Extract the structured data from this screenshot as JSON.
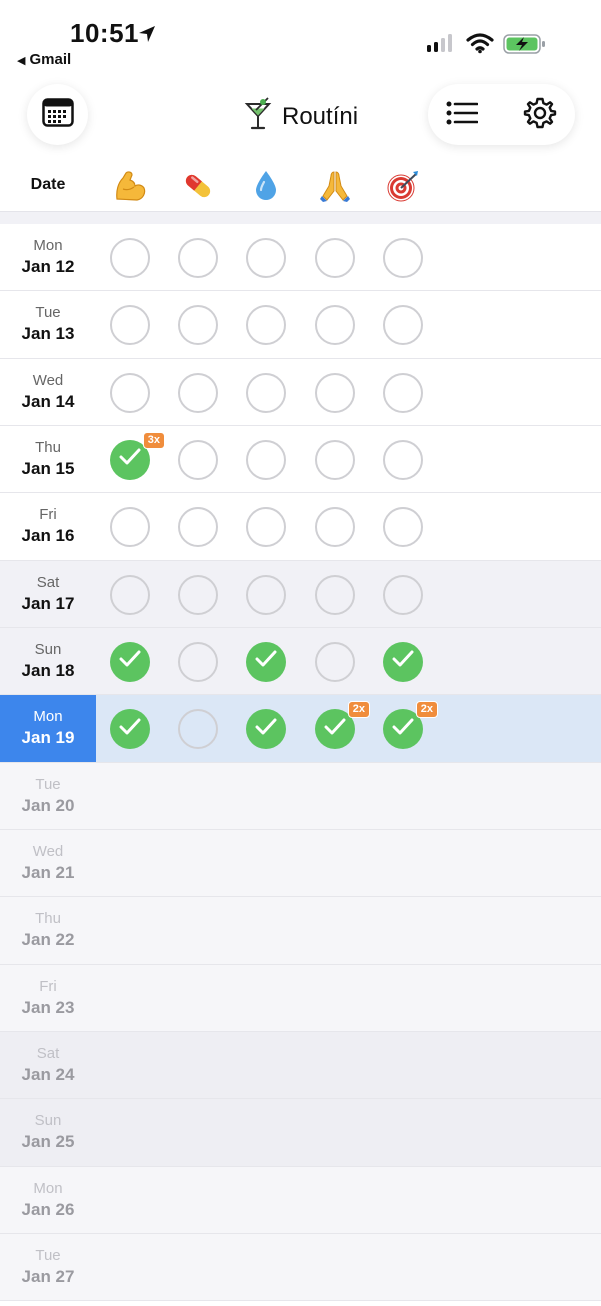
{
  "status_bar": {
    "time": "10:51",
    "back_app": "Gmail"
  },
  "app": {
    "title": "Routíni"
  },
  "columns": {
    "date_label": "Date",
    "habits": [
      {
        "emoji": "💪",
        "name": "flexed-biceps"
      },
      {
        "emoji": "💊",
        "name": "pill"
      },
      {
        "emoji": "💧",
        "name": "droplet"
      },
      {
        "emoji": "🙏",
        "name": "folded-hands"
      },
      {
        "emoji": "🎯",
        "name": "direct-hit"
      }
    ]
  },
  "rows": [
    {
      "dow": "Mon",
      "date": "Jan 12",
      "state": "past",
      "checks": [
        0,
        0,
        0,
        0,
        0
      ]
    },
    {
      "dow": "Tue",
      "date": "Jan 13",
      "state": "past",
      "checks": [
        0,
        0,
        0,
        0,
        0
      ]
    },
    {
      "dow": "Wed",
      "date": "Jan 14",
      "state": "past",
      "checks": [
        0,
        0,
        0,
        0,
        0
      ]
    },
    {
      "dow": "Thu",
      "date": "Jan 15",
      "state": "past",
      "checks": [
        1,
        0,
        0,
        0,
        0
      ],
      "badges": [
        "3x",
        "",
        "",
        "",
        ""
      ]
    },
    {
      "dow": "Fri",
      "date": "Jan 16",
      "state": "past",
      "checks": [
        0,
        0,
        0,
        0,
        0
      ]
    },
    {
      "dow": "Sat",
      "date": "Jan 17",
      "state": "past",
      "weekend": true,
      "checks": [
        0,
        0,
        0,
        0,
        0
      ]
    },
    {
      "dow": "Sun",
      "date": "Jan 18",
      "state": "past",
      "weekend": true,
      "checks": [
        1,
        0,
        1,
        0,
        1
      ]
    },
    {
      "dow": "Mon",
      "date": "Jan 19",
      "state": "today",
      "checks": [
        1,
        0,
        1,
        1,
        1
      ],
      "badges": [
        "",
        "",
        "",
        "2x",
        "2x"
      ]
    },
    {
      "dow": "Tue",
      "date": "Jan 20",
      "state": "future"
    },
    {
      "dow": "Wed",
      "date": "Jan 21",
      "state": "future"
    },
    {
      "dow": "Thu",
      "date": "Jan 22",
      "state": "future"
    },
    {
      "dow": "Fri",
      "date": "Jan 23",
      "state": "future"
    },
    {
      "dow": "Sat",
      "date": "Jan 24",
      "state": "future",
      "weekend": true
    },
    {
      "dow": "Sun",
      "date": "Jan 25",
      "state": "future",
      "weekend": true
    },
    {
      "dow": "Mon",
      "date": "Jan 26",
      "state": "future"
    },
    {
      "dow": "Tue",
      "date": "Jan 27",
      "state": "future"
    }
  ],
  "colors": {
    "accent_blue": "#3d86ec",
    "check_green": "#5cc460",
    "badge_orange": "#f08d3c",
    "today_row": "#dbe7f6"
  }
}
